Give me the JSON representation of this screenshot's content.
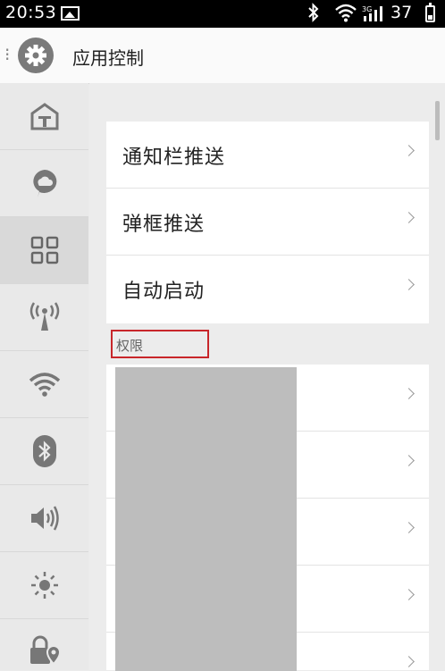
{
  "status_bar": {
    "time": "20:53",
    "network_type": "3G",
    "battery": "37",
    "icons": [
      "image-icon",
      "bluetooth-icon",
      "wifi-icon",
      "signal-icon",
      "battery-icon"
    ]
  },
  "header": {
    "title": "应用控制",
    "icon": "gear-icon"
  },
  "sidebar": {
    "items": [
      {
        "icon": "home-icon"
      },
      {
        "icon": "cloud-icon"
      },
      {
        "icon": "apps-grid-icon",
        "active": true
      },
      {
        "icon": "antenna-icon"
      },
      {
        "icon": "wifi-icon"
      },
      {
        "icon": "bluetooth-icon"
      },
      {
        "icon": "volume-icon"
      },
      {
        "icon": "brightness-icon"
      },
      {
        "icon": "lock-location-icon"
      }
    ]
  },
  "main": {
    "menu_items": [
      {
        "label": "通知栏推送"
      },
      {
        "label": "弹框推送"
      },
      {
        "label": "自动启动"
      }
    ],
    "permissions_section_label": "权限",
    "permission_rows_count_visible": 5
  },
  "colors": {
    "highlight_box": "#c8262a",
    "redacted_block": "#bdbdbd"
  }
}
